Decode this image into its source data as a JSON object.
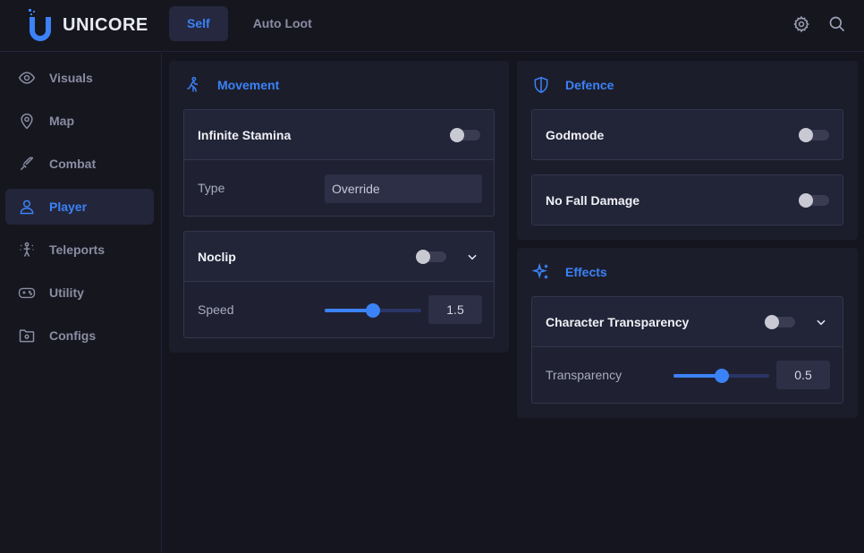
{
  "app": {
    "name": "UNICORE"
  },
  "colors": {
    "accent": "#3b82f6",
    "background": "#15151f",
    "panel": "#1c1d2b"
  },
  "top_tabs": [
    {
      "label": "Self",
      "active": true
    },
    {
      "label": "Auto Loot",
      "active": false
    }
  ],
  "header_icons": [
    "gear-icon",
    "search-icon"
  ],
  "sidebar": {
    "items": [
      {
        "label": "Visuals",
        "icon": "eye-icon",
        "active": false
      },
      {
        "label": "Map",
        "icon": "map-pin-icon",
        "active": false
      },
      {
        "label": "Combat",
        "icon": "sword-icon",
        "active": false
      },
      {
        "label": "Player",
        "icon": "user-icon",
        "active": true
      },
      {
        "label": "Teleports",
        "icon": "teleport-icon",
        "active": false
      },
      {
        "label": "Utility",
        "icon": "gamepad-icon",
        "active": false
      },
      {
        "label": "Configs",
        "icon": "folder-gear-icon",
        "active": false
      }
    ]
  },
  "movement": {
    "title": "Movement",
    "infinite_stamina": {
      "label": "Infinite Stamina",
      "enabled": false
    },
    "type": {
      "label": "Type",
      "value": "Override"
    },
    "noclip": {
      "label": "Noclip",
      "enabled": false
    },
    "speed": {
      "label": "Speed",
      "value": "1.5",
      "fraction": 0.5
    }
  },
  "defence": {
    "title": "Defence",
    "godmode": {
      "label": "Godmode",
      "enabled": false
    },
    "no_fall_damage": {
      "label": "No Fall Damage",
      "enabled": false
    }
  },
  "effects": {
    "title": "Effects",
    "character_transparency": {
      "label": "Character Transparency",
      "enabled": false
    },
    "transparency": {
      "label": "Transparency",
      "value": "0.5",
      "fraction": 0.5
    }
  }
}
